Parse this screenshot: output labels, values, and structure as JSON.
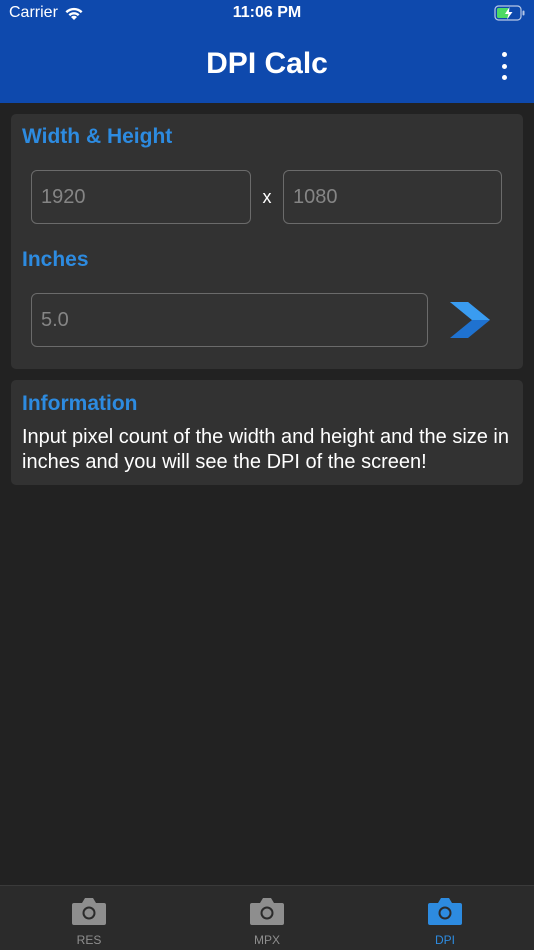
{
  "status_bar": {
    "carrier": "Carrier",
    "time": "11:06 PM",
    "icons": [
      "wifi-icon",
      "battery-charging-icon"
    ]
  },
  "nav": {
    "title": "DPI Calc",
    "menu_icon": "more-vertical-icon"
  },
  "dimensions": {
    "label": "Width & Height",
    "width_placeholder": "1920",
    "width_value": "",
    "separator": "x",
    "height_placeholder": "1080",
    "height_value": ""
  },
  "inches": {
    "label": "Inches",
    "placeholder": "5.0",
    "value": "",
    "go_icon": "chevron-right-icon"
  },
  "info": {
    "title": "Information",
    "text": "Input pixel count of the width and height and the size in inches and you will see the DPI of the screen!"
  },
  "tabs": [
    {
      "label": "RES",
      "icon": "camera-icon",
      "active": false
    },
    {
      "label": "MPX",
      "icon": "camera-icon",
      "active": false
    },
    {
      "label": "DPI",
      "icon": "camera-icon",
      "active": true
    }
  ],
  "colors": {
    "header": "#0e49ad",
    "accent": "#2d8be0",
    "background": "#222222",
    "card": "#323232",
    "tab_inactive": "#8e8e8e"
  }
}
